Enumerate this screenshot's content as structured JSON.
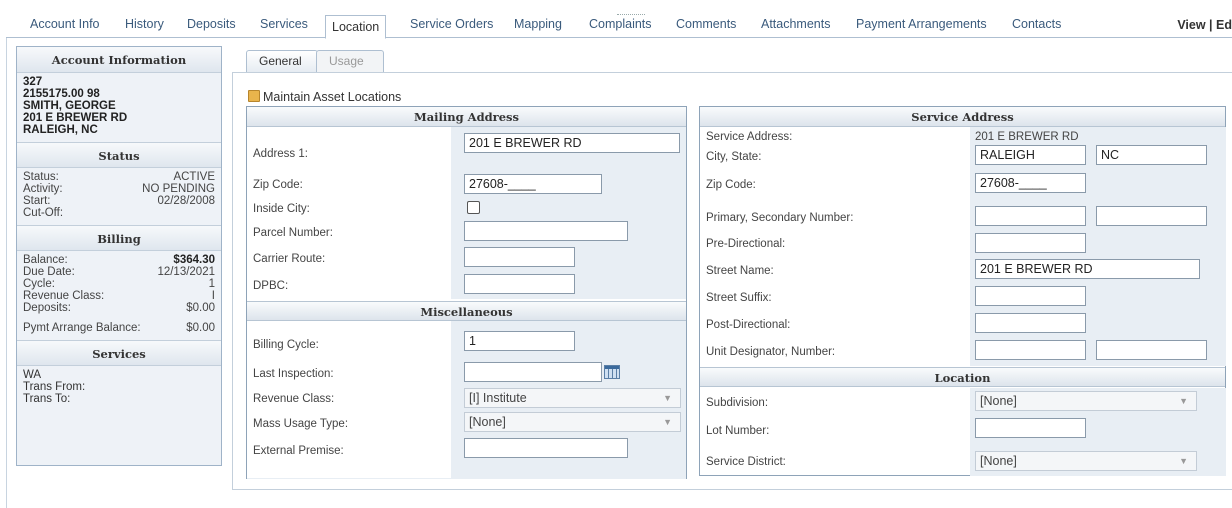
{
  "top_tabs": [
    "Account Info",
    "History",
    "Deposits",
    "Services",
    "Location",
    "Service Orders",
    "Mapping",
    "Complaints",
    "Comments",
    "Attachments",
    "Payment Arrangements",
    "Contacts"
  ],
  "top_right": "View | Ed",
  "sidebar": {
    "account_title": "Account Information",
    "account_lines": [
      "327",
      "2155175.00 98",
      "SMITH, GEORGE",
      "201 E BREWER RD",
      "RALEIGH, NC"
    ],
    "status_title": "Status",
    "status": [
      {
        "label": "Status:",
        "value": "ACTIVE"
      },
      {
        "label": "Activity:",
        "value": "NO PENDING"
      },
      {
        "label": "Start:",
        "value": "02/28/2008"
      },
      {
        "label": "Cut-Off:",
        "value": ""
      }
    ],
    "billing_title": "Billing",
    "billing": [
      {
        "label": "Balance:",
        "value": "$364.30"
      },
      {
        "label": "Due Date:",
        "value": "12/13/2021"
      },
      {
        "label": "Cycle:",
        "value": "1"
      },
      {
        "label": "Revenue Class:",
        "value": "I"
      },
      {
        "label": "Deposits:",
        "value": "$0.00"
      },
      {
        "label": "Pymt Arrange Balance:",
        "value": "$0.00"
      }
    ],
    "services_title": "Services",
    "services_lines": [
      "WA",
      "Trans From:",
      "Trans To:"
    ]
  },
  "sub_tabs": {
    "general": "General",
    "usage": "Usage"
  },
  "maintain_title": "Maintain Asset Locations",
  "mailing": {
    "title": "Mailing Address",
    "address1_label": "Address 1:",
    "address1": "201 E BREWER RD",
    "zip_label": "Zip Code:",
    "zip": "27608-____",
    "inside_city_label": "Inside City:",
    "parcel_label": "Parcel Number:",
    "parcel": "",
    "carrier_label": "Carrier Route:",
    "carrier": "",
    "dpbc_label": "DPBC:",
    "dpbc": ""
  },
  "misc": {
    "title": "Miscellaneous",
    "billing_cycle_label": "Billing Cycle:",
    "billing_cycle": "1",
    "last_inspection_label": "Last Inspection:",
    "last_inspection": "",
    "revenue_class_label": "Revenue Class:",
    "revenue_class": "[I] Institute",
    "mass_usage_label": "Mass Usage Type:",
    "mass_usage": "[None]",
    "external_premise_label": "External Premise:",
    "external_premise": ""
  },
  "service": {
    "title": "Service Address",
    "service_address_label": "Service Address:",
    "service_address": "201 E BREWER RD",
    "city_state_label": "City, State:",
    "city": "RALEIGH",
    "state": "NC",
    "zip_label": "Zip Code:",
    "zip": "27608-____",
    "primary_label": "Primary, Secondary Number:",
    "predir_label": "Pre-Directional:",
    "street_name_label": "Street Name:",
    "street_name": "201 E BREWER RD",
    "street_suffix_label": "Street Suffix:",
    "postdir_label": "Post-Directional:",
    "unit_label": "Unit Designator, Number:"
  },
  "location": {
    "title": "Location",
    "subdivision_label": "Subdivision:",
    "subdivision": "[None]",
    "lot_label": "Lot Number:",
    "district_label": "Service District:",
    "district": "[None]"
  }
}
